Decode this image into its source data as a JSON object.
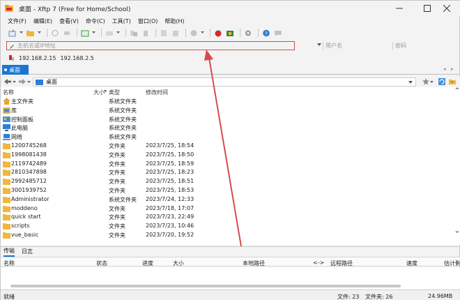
{
  "window": {
    "title": "桌面 - Xftp 7 (Free for Home/School)"
  },
  "menu": [
    "文件(F)",
    "编辑(E)",
    "查看(V)",
    "命令(C)",
    "工具(T)",
    "窗口(O)",
    "帮助(H)"
  ],
  "address": {
    "placeholder": "主机名或IP地址",
    "username_placeholder": "用户名",
    "password_placeholder": "密码"
  },
  "sessions": [
    "192.168.2.15",
    "192.168.2.5"
  ],
  "tab": {
    "label": "桌面"
  },
  "path": {
    "current": "桌面"
  },
  "columns": {
    "name": "名称",
    "size": "大小",
    "type": "类型",
    "modified": "修改时间"
  },
  "files": [
    {
      "name": "主文件夹",
      "type": "系统文件夹",
      "modified": "",
      "icon": "home-folder-icon"
    },
    {
      "name": "库",
      "type": "系统文件夹",
      "modified": "",
      "icon": "library-icon"
    },
    {
      "name": "控制面板",
      "type": "系统文件夹",
      "modified": "",
      "icon": "control-panel-icon"
    },
    {
      "name": "此电脑",
      "type": "系统文件夹",
      "modified": "",
      "icon": "computer-icon"
    },
    {
      "name": "网络",
      "type": "系统文件夹",
      "modified": "",
      "icon": "network-icon"
    },
    {
      "name": "1200745268",
      "type": "文件夹",
      "modified": "2023/7/25, 18:54",
      "icon": "folder-icon"
    },
    {
      "name": "1998081438",
      "type": "文件夹",
      "modified": "2023/7/25, 18:50",
      "icon": "folder-icon"
    },
    {
      "name": "2119742489",
      "type": "文件夹",
      "modified": "2023/7/25, 18:59",
      "icon": "folder-icon"
    },
    {
      "name": "2810347898",
      "type": "文件夹",
      "modified": "2023/7/25, 18:23",
      "icon": "folder-icon"
    },
    {
      "name": "2992485712",
      "type": "文件夹",
      "modified": "2023/7/25, 18:51",
      "icon": "folder-icon"
    },
    {
      "name": "3001939752",
      "type": "文件夹",
      "modified": "2023/7/25, 18:53",
      "icon": "folder-icon"
    },
    {
      "name": "Administrator",
      "type": "系统文件夹",
      "modified": "2023/7/24, 12:33",
      "icon": "folder-icon"
    },
    {
      "name": "moddeno",
      "type": "文件夹",
      "modified": "2023/7/18, 17:07",
      "icon": "folder-icon"
    },
    {
      "name": "quick start",
      "type": "文件夹",
      "modified": "2023/7/23, 22:49",
      "icon": "folder-icon"
    },
    {
      "name": "scripts",
      "type": "文件夹",
      "modified": "2023/7/23, 10:46",
      "icon": "folder-icon"
    },
    {
      "name": "vue_basic",
      "type": "文件夹",
      "modified": "2023/7/20, 19:52",
      "icon": "folder-icon"
    }
  ],
  "lower_tabs": [
    "传输",
    "日志"
  ],
  "transfer_columns": [
    "名称",
    "状态",
    "进度",
    "大小",
    "本地路径",
    "<->",
    "远程路径",
    "速度",
    "估计剩"
  ],
  "status": {
    "ready": "就绪",
    "files": "文件: 23",
    "folders": "文件夹: 26",
    "size": "24.96MB"
  },
  "colors": {
    "accent": "#1976d2",
    "highlight": "#d94a4a",
    "folder": "#f0b73a"
  }
}
